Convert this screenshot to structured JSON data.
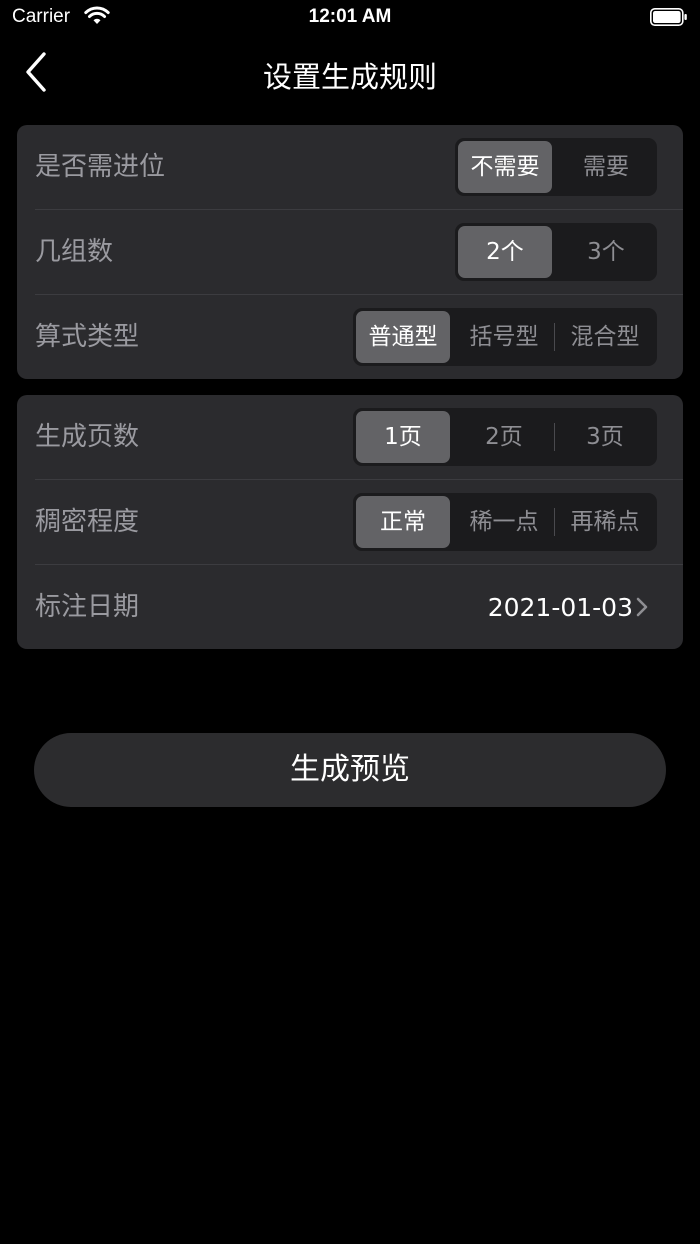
{
  "status_bar": {
    "carrier": "Carrier",
    "time": "12:01 AM"
  },
  "nav": {
    "title": "设置生成规则",
    "back_icon": "chevron-left-icon"
  },
  "colors": {
    "background": "#000000",
    "card": "#2b2b2e",
    "segment_track": "#1b1b1d",
    "segment_selected": "#636366",
    "label": "#9a9aa0",
    "button": "#2c2c2e"
  },
  "section1": {
    "carry": {
      "label": "是否需进位",
      "options": [
        "不需要",
        "需要"
      ],
      "selected": 0
    },
    "groups": {
      "label": "几组数",
      "options": [
        "2个",
        "3个"
      ],
      "selected": 0
    },
    "formula_type": {
      "label": "算式类型",
      "options": [
        "普通型",
        "括号型",
        "混合型"
      ],
      "selected": 0
    }
  },
  "section2": {
    "pages": {
      "label": "生成页数",
      "options": [
        "1页",
        "2页",
        "3页"
      ],
      "selected": 0
    },
    "density": {
      "label": "稠密程度",
      "options": [
        "正常",
        "稀一点",
        "再稀点"
      ],
      "selected": 0
    },
    "date": {
      "label": "标注日期",
      "value": "2021-01-03"
    }
  },
  "generate_button": {
    "label": "生成预览"
  }
}
